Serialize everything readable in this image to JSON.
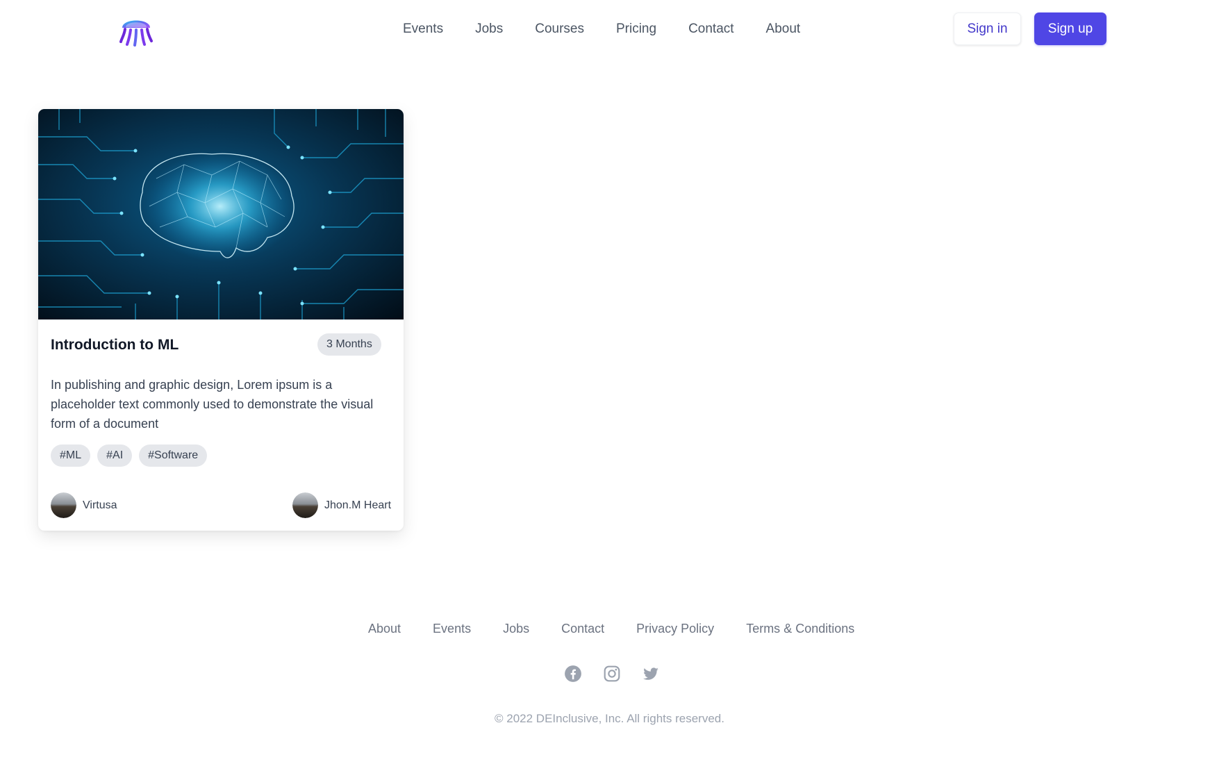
{
  "header": {
    "logo_icon": "jellyfish-logo-icon",
    "nav": [
      "Events",
      "Jobs",
      "Courses",
      "Pricing",
      "Contact",
      "About"
    ],
    "signin_label": "Sign in",
    "signup_label": "Sign up"
  },
  "course_card": {
    "image_icon": "brain-circuit-image",
    "title": "Introduction to ML",
    "duration": "3 Months",
    "description": "In publishing and graphic design, Lorem ipsum is a placeholder text commonly used to demonstrate the visual form of a document",
    "tags": [
      "#ML",
      "#AI",
      "#Software"
    ],
    "company": "Virtusa",
    "instructor": "Jhon.M Heart"
  },
  "footer": {
    "links": [
      "About",
      "Events",
      "Jobs",
      "Contact",
      "Privacy Policy",
      "Terms & Conditions"
    ],
    "social_icons": [
      "facebook-icon",
      "instagram-icon",
      "twitter-icon"
    ],
    "copyright": "© 2022 DEInclusive, Inc. All rights reserved."
  },
  "colors": {
    "primary": "#4f46e5",
    "primary_text": "#4338ca",
    "muted_text": "#6b7280",
    "tag_bg": "#e5e7eb"
  }
}
